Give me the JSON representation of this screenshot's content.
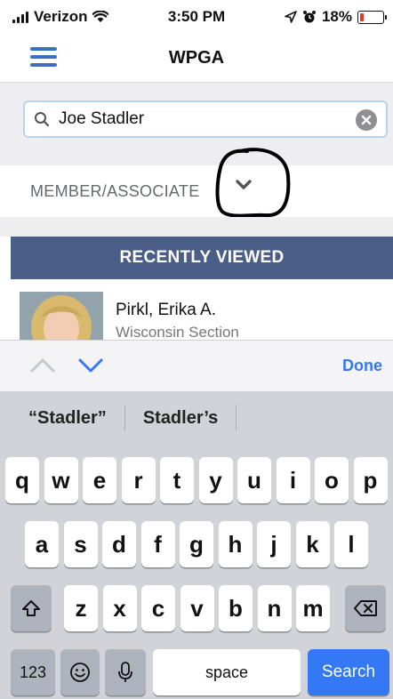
{
  "status_bar": {
    "carrier": "Verizon",
    "time": "3:50 PM",
    "battery_percent": "18%",
    "battery_level": 0.18
  },
  "nav": {
    "title": "WPGA"
  },
  "search": {
    "value": "Joe Stadler"
  },
  "filter": {
    "label": "MEMBER/ASSOCIATE"
  },
  "recently_viewed": {
    "header": "RECENTLY VIEWED",
    "items": [
      {
        "name": "Pirkl, Erika A.",
        "section": "Wisconsin Section"
      }
    ]
  },
  "accessory": {
    "done_label": "Done"
  },
  "keyboard": {
    "suggestions": [
      "“Stadler”",
      "Stadler’s"
    ],
    "row1": [
      "q",
      "w",
      "e",
      "r",
      "t",
      "y",
      "u",
      "i",
      "o",
      "p"
    ],
    "row2": [
      "a",
      "s",
      "d",
      "f",
      "g",
      "h",
      "j",
      "k",
      "l"
    ],
    "row3": [
      "z",
      "x",
      "c",
      "v",
      "b",
      "n",
      "m"
    ],
    "numbers_label": "123",
    "space_label": "space",
    "search_label": "Search"
  },
  "colors": {
    "accent": "#3d6fbe",
    "header_bg": "#4a5e87",
    "ios_blue": "#3478f6",
    "battery_low": "#e5352b"
  }
}
